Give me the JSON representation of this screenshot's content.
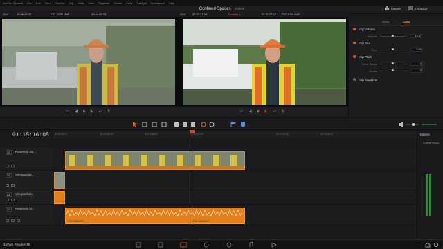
{
  "menu": [
    "DaVinci Resolve",
    "File",
    "Edit",
    "Trim",
    "Timeline",
    "Clip",
    "Mark",
    "View",
    "Playback",
    "Fusion",
    "Color",
    "Fairlight",
    "Workspace",
    "Help"
  ],
  "project": {
    "title": "Confined Spaces",
    "status": "Edited"
  },
  "top_right": {
    "meters_label": "Meters",
    "inspector_label": "Inspector"
  },
  "source": {
    "zoom": "35%",
    "tc_in": "00:06:39:20",
    "clip": "FS7-1260.MXF",
    "tc_out": "00:03:01:02"
  },
  "program": {
    "zoom": "35%",
    "tc_in": "00:21:17:09",
    "timeline": "Timeline 1",
    "tc_out": "01:15:07:12",
    "clip": "FS7-1260.MXF"
  },
  "inspector": {
    "tabs": [
      "Video",
      "Audio"
    ],
    "active_tab": "Audio",
    "sections": [
      {
        "title": "Clip Volume",
        "params": [
          {
            "label": "Volume",
            "value": "10.67"
          }
        ]
      },
      {
        "title": "Clip Pan",
        "params": [
          {
            "label": "Pan",
            "value": "0.00"
          }
        ]
      },
      {
        "title": "Clip Pitch",
        "params": [
          {
            "label": "Semi Tones",
            "value": "0"
          },
          {
            "label": "Cents",
            "value": "0"
          }
        ]
      },
      {
        "title": "Clip Equalizer",
        "params": []
      }
    ]
  },
  "timeline": {
    "timecode": "01:15:16:05",
    "ruler": [
      "01:00:00:00",
      "01:14:50:00",
      "01:14:56:00",
      "01:15:04:00",
      "01:15:12:00",
      "01:15:20:00"
    ],
    "tracks": [
      {
        "id": "V2",
        "name": "Reservoir int..."
      },
      {
        "id": "V1",
        "name": "Vineyard int..."
      },
      {
        "id": "A1",
        "name": "Vineyard int..."
      },
      {
        "id": "A2",
        "name": "Reservoir in..."
      }
    ],
    "audio_clip_label": "FS7-1260.MXF",
    "audio_clip_label2": "FS7-1260.MXF"
  },
  "meters": {
    "title": "Meters",
    "bus": "Control Room"
  },
  "footer": {
    "app": "DaVinci Resolve 16"
  },
  "colors": {
    "accent": "#e46a2a",
    "clip_video": "#c77828",
    "clip_audio": "#e07f1c",
    "playhead": "#e0482a"
  }
}
